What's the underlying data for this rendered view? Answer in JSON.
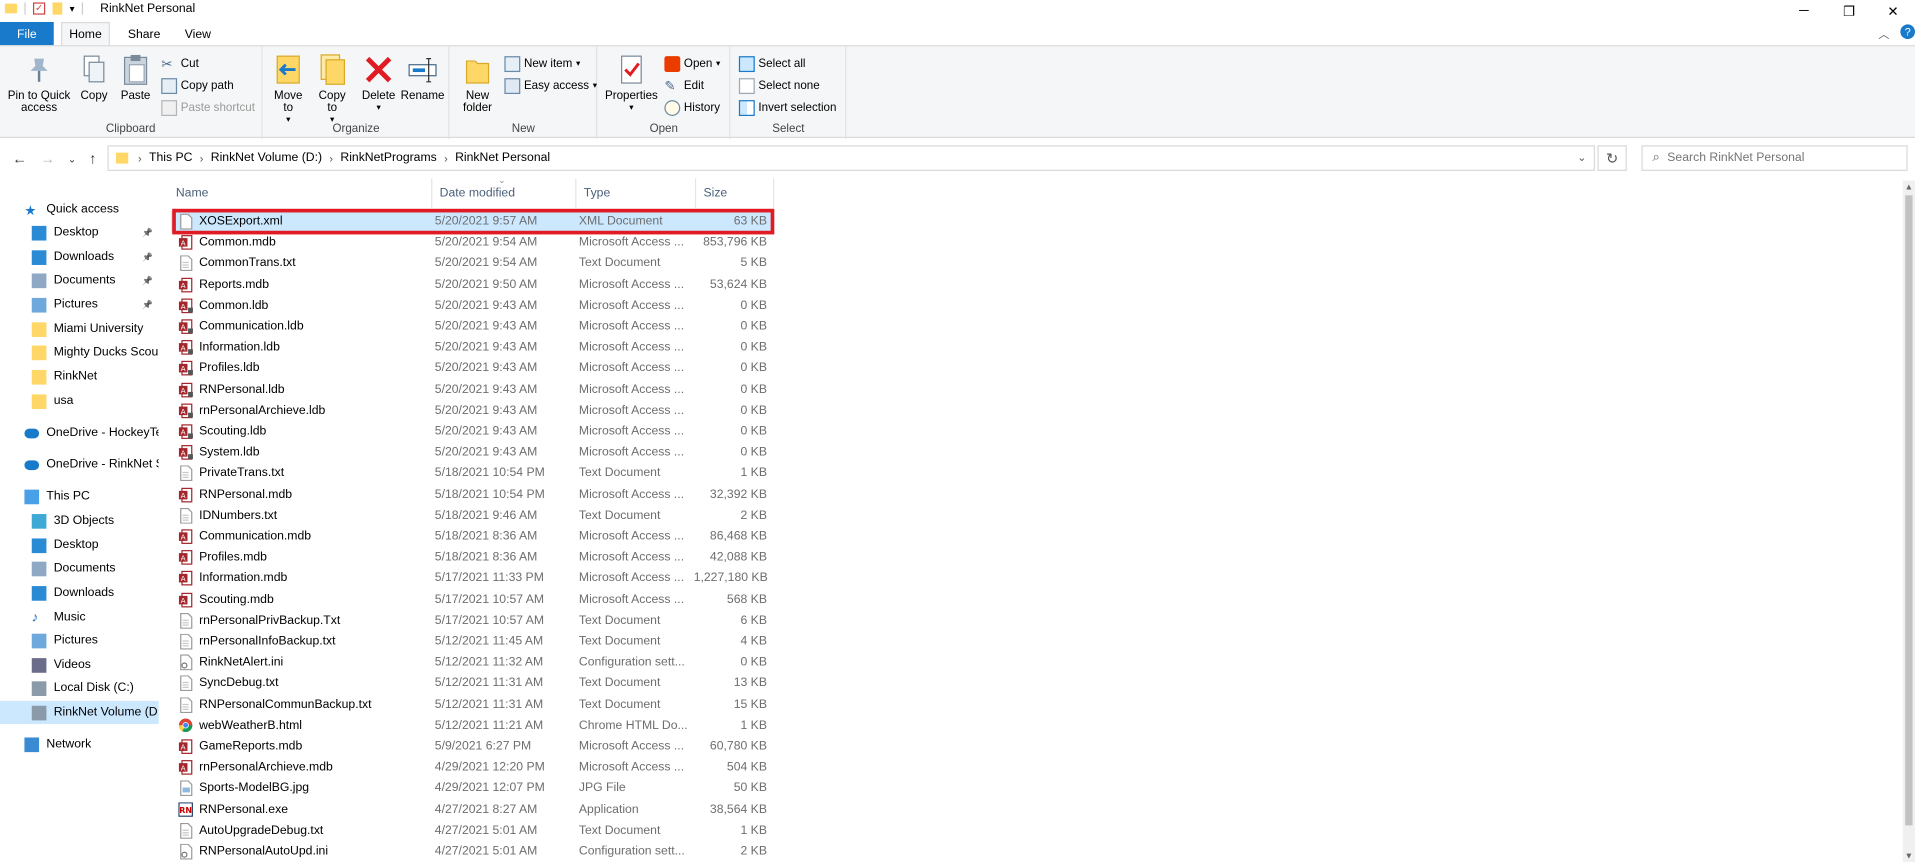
{
  "window": {
    "title": "RinkNet Personal",
    "minimize_glyph": "─",
    "maximize_glyph": "❐",
    "close_glyph": "✕"
  },
  "ribbon_tabs": [
    "File",
    "Home",
    "Share",
    "View"
  ],
  "ribbon": {
    "clipboard": {
      "label": "Clipboard",
      "pin": "Pin to Quick access",
      "copy": "Copy",
      "paste": "Paste",
      "cut": "Cut",
      "copy_path": "Copy path",
      "paste_shortcut": "Paste shortcut"
    },
    "organize": {
      "label": "Organize",
      "move_to": "Move to",
      "copy_to": "Copy to",
      "delete": "Delete",
      "rename": "Rename"
    },
    "new": {
      "label": "New",
      "new_folder": "New folder",
      "new_item": "New item",
      "easy_access": "Easy access"
    },
    "open": {
      "label": "Open",
      "properties": "Properties",
      "open": "Open",
      "edit": "Edit",
      "history": "History"
    },
    "select": {
      "label": "Select",
      "select_all": "Select all",
      "select_none": "Select none",
      "invert": "Invert selection"
    }
  },
  "address": {
    "crumbs": [
      "This PC",
      "RinkNet Volume (D:)",
      "RinkNetPrograms",
      "RinkNet Personal"
    ],
    "search_placeholder": "Search RinkNet Personal"
  },
  "nav": [
    {
      "label": "Quick access",
      "icon": "star-icon",
      "pinned": false
    },
    {
      "label": "Desktop",
      "icon": "desktop-icon",
      "pinned": true
    },
    {
      "label": "Downloads",
      "icon": "download-icon",
      "pinned": true
    },
    {
      "label": "Documents",
      "icon": "documents-icon",
      "pinned": true
    },
    {
      "label": "Pictures",
      "icon": "pictures-icon",
      "pinned": true
    },
    {
      "label": "Miami University",
      "icon": "folder-icon",
      "pinned": false
    },
    {
      "label": "Mighty Ducks Scou",
      "icon": "folder-icon",
      "pinned": false
    },
    {
      "label": "RinkNet",
      "icon": "folder-icon",
      "pinned": false
    },
    {
      "label": "usa",
      "icon": "folder-icon",
      "pinned": false
    },
    {
      "label": "OneDrive - HockeyTe",
      "icon": "cloud-icon",
      "pinned": false
    },
    {
      "label": "OneDrive - RinkNet S",
      "icon": "cloud-icon",
      "pinned": false
    },
    {
      "label": "This PC",
      "icon": "computer-icon",
      "pinned": false
    },
    {
      "label": "3D Objects",
      "icon": "cube-icon",
      "pinned": false
    },
    {
      "label": "Desktop",
      "icon": "desktop-icon",
      "pinned": false
    },
    {
      "label": "Documents",
      "icon": "documents-icon",
      "pinned": false
    },
    {
      "label": "Downloads",
      "icon": "download-icon",
      "pinned": false
    },
    {
      "label": "Music",
      "icon": "music-icon",
      "pinned": false
    },
    {
      "label": "Pictures",
      "icon": "pictures-icon",
      "pinned": false
    },
    {
      "label": "Videos",
      "icon": "video-icon",
      "pinned": false
    },
    {
      "label": "Local Disk (C:)",
      "icon": "drive-icon",
      "pinned": false
    },
    {
      "label": "RinkNet Volume (D:",
      "icon": "drive-icon",
      "pinned": false,
      "selected": true
    },
    {
      "label": "Network",
      "icon": "network-icon",
      "pinned": false
    }
  ],
  "columns": {
    "name": "Name",
    "date": "Date modified",
    "type": "Type",
    "size": "Size"
  },
  "files": [
    {
      "name": "XOSExport.xml",
      "date": "5/20/2021 9:57 AM",
      "type": "XML Document",
      "size": "63 KB",
      "icon": "file-icon",
      "selected": true
    },
    {
      "name": "Common.mdb",
      "date": "5/20/2021 9:54 AM",
      "type": "Microsoft Access ...",
      "size": "853,796 KB",
      "icon": "access-file-icon"
    },
    {
      "name": "CommonTrans.txt",
      "date": "5/20/2021 9:54 AM",
      "type": "Text Document",
      "size": "5 KB",
      "icon": "text-file-icon"
    },
    {
      "name": "Reports.mdb",
      "date": "5/20/2021 9:50 AM",
      "type": "Microsoft Access ...",
      "size": "53,624 KB",
      "icon": "access-file-icon"
    },
    {
      "name": "Common.ldb",
      "date": "5/20/2021 9:43 AM",
      "type": "Microsoft Access ...",
      "size": "0 KB",
      "icon": "access-lock-icon"
    },
    {
      "name": "Communication.ldb",
      "date": "5/20/2021 9:43 AM",
      "type": "Microsoft Access ...",
      "size": "0 KB",
      "icon": "access-lock-icon"
    },
    {
      "name": "Information.ldb",
      "date": "5/20/2021 9:43 AM",
      "type": "Microsoft Access ...",
      "size": "0 KB",
      "icon": "access-lock-icon"
    },
    {
      "name": "Profiles.ldb",
      "date": "5/20/2021 9:43 AM",
      "type": "Microsoft Access ...",
      "size": "0 KB",
      "icon": "access-lock-icon"
    },
    {
      "name": "RNPersonal.ldb",
      "date": "5/20/2021 9:43 AM",
      "type": "Microsoft Access ...",
      "size": "0 KB",
      "icon": "access-lock-icon"
    },
    {
      "name": "rnPersonalArchieve.ldb",
      "date": "5/20/2021 9:43 AM",
      "type": "Microsoft Access ...",
      "size": "0 KB",
      "icon": "access-lock-icon"
    },
    {
      "name": "Scouting.ldb",
      "date": "5/20/2021 9:43 AM",
      "type": "Microsoft Access ...",
      "size": "0 KB",
      "icon": "access-lock-icon"
    },
    {
      "name": "System.ldb",
      "date": "5/20/2021 9:43 AM",
      "type": "Microsoft Access ...",
      "size": "0 KB",
      "icon": "access-lock-icon"
    },
    {
      "name": "PrivateTrans.txt",
      "date": "5/18/2021 10:54 PM",
      "type": "Text Document",
      "size": "1 KB",
      "icon": "text-file-icon"
    },
    {
      "name": "RNPersonal.mdb",
      "date": "5/18/2021 10:54 PM",
      "type": "Microsoft Access ...",
      "size": "32,392 KB",
      "icon": "access-file-icon"
    },
    {
      "name": "IDNumbers.txt",
      "date": "5/18/2021 9:46 AM",
      "type": "Text Document",
      "size": "2 KB",
      "icon": "text-file-icon"
    },
    {
      "name": "Communication.mdb",
      "date": "5/18/2021 8:36 AM",
      "type": "Microsoft Access ...",
      "size": "86,468 KB",
      "icon": "access-file-icon"
    },
    {
      "name": "Profiles.mdb",
      "date": "5/18/2021 8:36 AM",
      "type": "Microsoft Access ...",
      "size": "42,088 KB",
      "icon": "access-file-icon"
    },
    {
      "name": "Information.mdb",
      "date": "5/17/2021 11:33 PM",
      "type": "Microsoft Access ...",
      "size": "1,227,180 KB",
      "icon": "access-file-icon"
    },
    {
      "name": "Scouting.mdb",
      "date": "5/17/2021 10:57 AM",
      "type": "Microsoft Access ...",
      "size": "568 KB",
      "icon": "access-file-icon"
    },
    {
      "name": "rnPersonalPrivBackup.Txt",
      "date": "5/17/2021 10:57 AM",
      "type": "Text Document",
      "size": "6 KB",
      "icon": "text-file-icon"
    },
    {
      "name": "rnPersonalInfoBackup.txt",
      "date": "5/12/2021 11:45 AM",
      "type": "Text Document",
      "size": "4 KB",
      "icon": "text-file-icon"
    },
    {
      "name": "RinkNetAlert.ini",
      "date": "5/12/2021 11:32 AM",
      "type": "Configuration sett...",
      "size": "0 KB",
      "icon": "config-file-icon"
    },
    {
      "name": "SyncDebug.txt",
      "date": "5/12/2021 11:31 AM",
      "type": "Text Document",
      "size": "13 KB",
      "icon": "text-file-icon"
    },
    {
      "name": "RNPersonalCommunBackup.txt",
      "date": "5/12/2021 11:31 AM",
      "type": "Text Document",
      "size": "15 KB",
      "icon": "text-file-icon"
    },
    {
      "name": "webWeatherB.html",
      "date": "5/12/2021 11:21 AM",
      "type": "Chrome HTML Do...",
      "size": "1 KB",
      "icon": "chrome-html-icon"
    },
    {
      "name": "GameReports.mdb",
      "date": "5/9/2021 6:27 PM",
      "type": "Microsoft Access ...",
      "size": "60,780 KB",
      "icon": "access-file-icon"
    },
    {
      "name": "rnPersonalArchieve.mdb",
      "date": "4/29/2021 12:20 PM",
      "type": "Microsoft Access ...",
      "size": "504 KB",
      "icon": "access-file-icon"
    },
    {
      "name": "Sports-ModelBG.jpg",
      "date": "4/29/2021 12:07 PM",
      "type": "JPG File",
      "size": "50 KB",
      "icon": "image-file-icon"
    },
    {
      "name": "RNPersonal.exe",
      "date": "4/27/2021 8:27 AM",
      "type": "Application",
      "size": "38,564 KB",
      "icon": "exe-file-icon"
    },
    {
      "name": "AutoUpgradeDebug.txt",
      "date": "4/27/2021 5:01 AM",
      "type": "Text Document",
      "size": "1 KB",
      "icon": "text-file-icon"
    },
    {
      "name": "RNPersonalAutoUpd.ini",
      "date": "4/27/2021 5:01 AM",
      "type": "Configuration sett...",
      "size": "2 KB",
      "icon": "config-file-icon"
    }
  ],
  "colors": {
    "accent": "#1979ca",
    "selection": "#cce8ff",
    "highlight_box": "#e01b24",
    "folder": "#ffd767",
    "access_red": "#a4262c"
  }
}
